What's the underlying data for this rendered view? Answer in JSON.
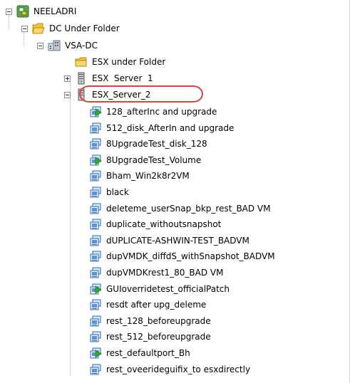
{
  "tree": {
    "datacenter_root": {
      "label": "NEELADRI",
      "expander": "collapse"
    },
    "folder": {
      "label": "DC Under Folder",
      "expander": "collapse"
    },
    "datacenter": {
      "label": "VSA-DC",
      "expander": "collapse"
    },
    "subfolder": {
      "label": "ESX under Folder"
    },
    "server1": {
      "label": "ESX  Server  1",
      "expander": "expand"
    },
    "server2": {
      "label": "ESX_Server_2",
      "expander": "collapse",
      "highlighted": true
    },
    "vms": [
      {
        "label": "128_afterInc and upgrade",
        "state": "powered-on"
      },
      {
        "label": "512_disk_AfterIn and upgrade",
        "state": "powered-off"
      },
      {
        "label": "8UpgradeTest_disk_128",
        "state": "powered-off"
      },
      {
        "label": "8UpgradeTest_Volume",
        "state": "powered-on"
      },
      {
        "label": "Bham_Win2k8r2VM",
        "state": "powered-off"
      },
      {
        "label": "black",
        "state": "powered-off"
      },
      {
        "label": "deleteme_userSnap_bkp_rest_BAD VM",
        "state": "powered-off"
      },
      {
        "label": "duplicate_withoutsnapshot",
        "state": "powered-off"
      },
      {
        "label": "dUPLICATE-ASHWIN-TEST_BADVM",
        "state": "powered-off"
      },
      {
        "label": "dupVMDK_diffdS_withSnapshot_BADVM",
        "state": "powered-off"
      },
      {
        "label": "dupVMDKrest1_80_BAD VM",
        "state": "powered-off"
      },
      {
        "label": "GUIoverridetest_officialPatch",
        "state": "powered-on"
      },
      {
        "label": "resdt after upg_deleme",
        "state": "powered-off"
      },
      {
        "label": "rest_128_beforeupgrade",
        "state": "powered-off"
      },
      {
        "label": "rest_512_beforeupgrade",
        "state": "powered-off"
      },
      {
        "label": "rest_defaultport_Bh",
        "state": "powered-on"
      },
      {
        "label": "rest_oveerideguifix_to esxdirectly",
        "state": "powered-off"
      }
    ]
  },
  "colors": {
    "highlight_ellipse": "#d9443a",
    "vm_icon_blue": "#3a78c8",
    "power_on_green": "#36a836",
    "folder_yellow": "#f2c23a"
  }
}
